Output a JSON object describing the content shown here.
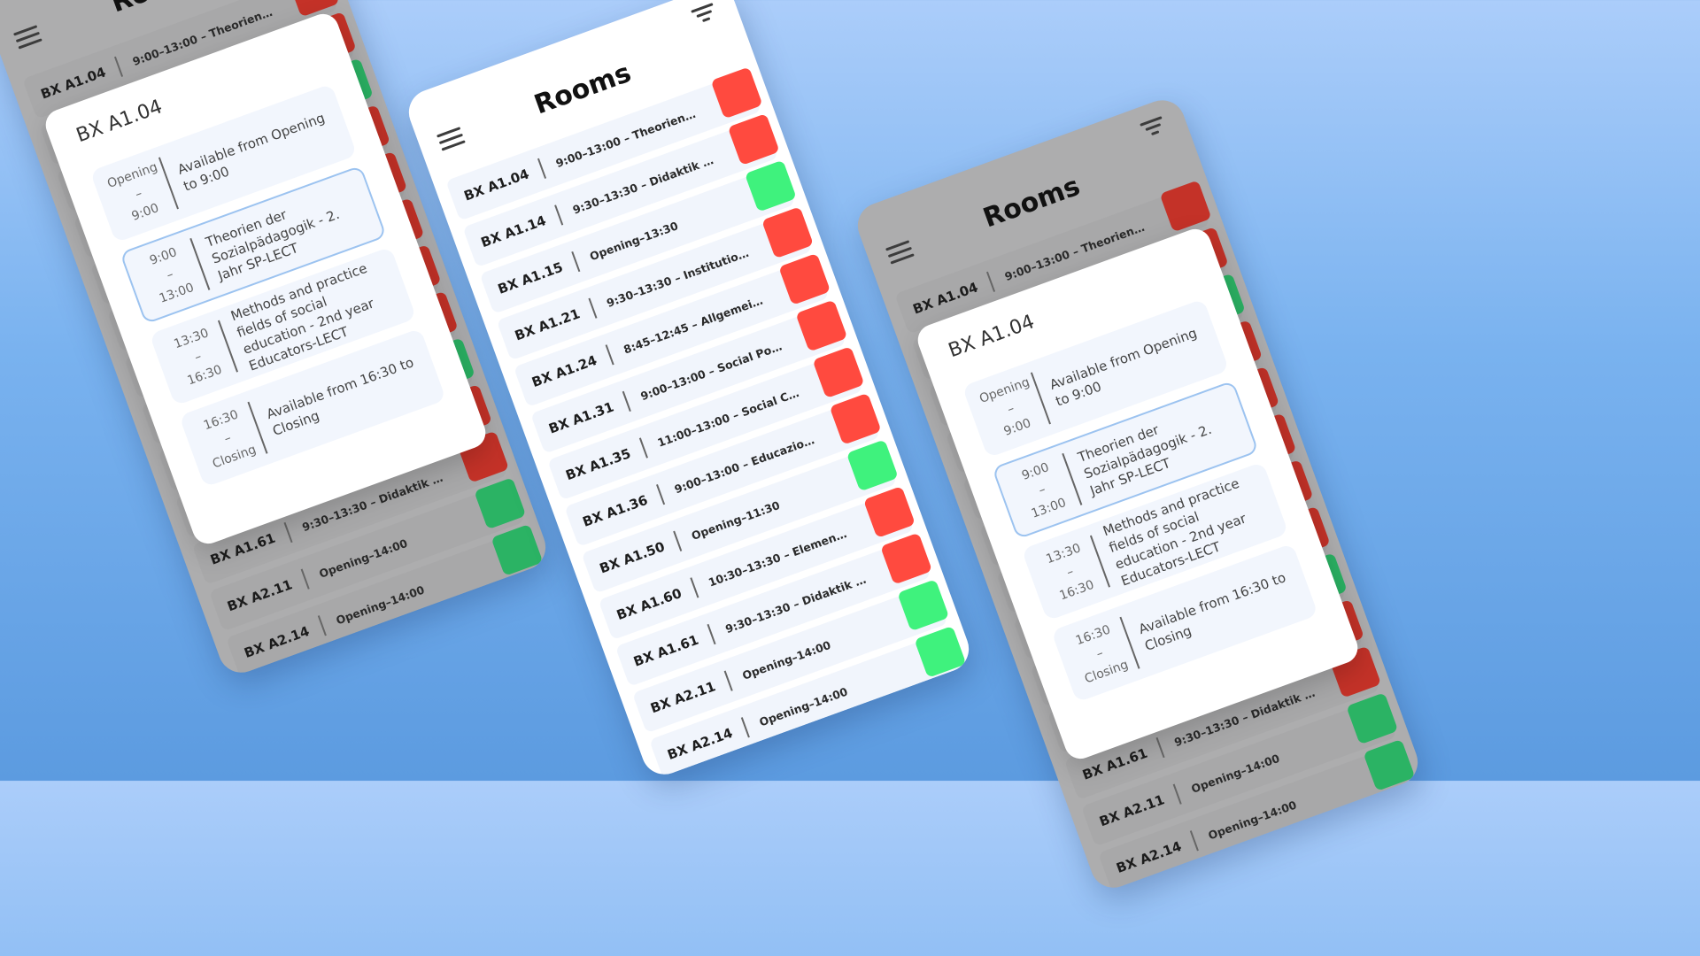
{
  "app": {
    "title": "Rooms"
  },
  "colors": {
    "busy": "#ff4a3f",
    "free": "#3ff27d",
    "background": "#79b2ef"
  },
  "rooms": [
    {
      "room": "BX A1.04",
      "booking": "9:00–13:00 – Theorien der…",
      "status": "busy"
    },
    {
      "room": "BX A1.14",
      "booking": "9:30–13:30 – Didaktik der…",
      "status": "busy"
    },
    {
      "room": "BX A1.15",
      "booking": "Opening–13:30",
      "status": "free"
    },
    {
      "room": "BX A1.21",
      "booking": "9:30–13:30 – Institutionell…",
      "status": "busy"
    },
    {
      "room": "BX A1.24",
      "booking": "8:45–12:45 – Allgemeine…",
      "status": "busy"
    },
    {
      "room": "BX A1.31",
      "booking": "9:00–13:00 – Social Policy…",
      "status": "busy"
    },
    {
      "room": "BX A1.35",
      "booking": "11:00–13:00 – Social Chan…",
      "status": "busy"
    },
    {
      "room": "BX A1.36",
      "booking": "9:00–13:00 – Educazione…",
      "status": "busy"
    },
    {
      "room": "BX A1.50",
      "booking": "Opening–11:30",
      "status": "free"
    },
    {
      "room": "BX A1.60",
      "booking": "10:30–13:30 – Elementi di…",
      "status": "busy"
    },
    {
      "room": "BX A1.61",
      "booking": "9:30–13:30 – Didaktik der…",
      "status": "busy"
    },
    {
      "room": "BX A2.11",
      "booking": "Opening–14:00",
      "status": "free"
    },
    {
      "room": "BX A2.14",
      "booking": "Opening–14:00",
      "status": "free"
    }
  ],
  "detail": {
    "room": "BX A1.04",
    "slots": [
      {
        "start": "Opening",
        "dash": "–",
        "end": "9:00",
        "text": "Available from Opening to 9:00",
        "active": false
      },
      {
        "start": "9:00",
        "dash": "–",
        "end": "13:00",
        "text": "Theorien der Sozialpädagogik - 2. Jahr SP-LECT",
        "active": true
      },
      {
        "start": "13:30",
        "dash": "–",
        "end": "16:30",
        "text": "Methods and practice fields of social education - 2nd year Educators-LECT",
        "active": false
      },
      {
        "start": "16:30",
        "dash": "–",
        "end": "Closing",
        "text": "Available from 16:30 to Closing",
        "active": false
      }
    ]
  }
}
